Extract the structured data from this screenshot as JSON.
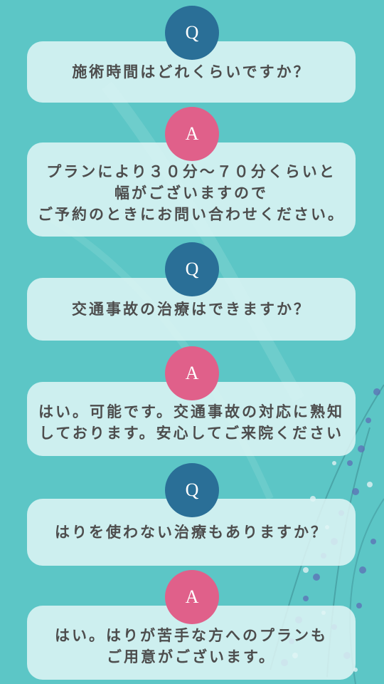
{
  "colors": {
    "background": "#5cc6c6",
    "q_badge": "#2a6f97",
    "a_badge": "#e0608a",
    "card": "#e0f6f6",
    "text": "#4d4d4d"
  },
  "faq": [
    {
      "q_badge": "Q",
      "question": [
        "施術時間はどれくらいですか？"
      ],
      "a_badge": "A",
      "answer": [
        "プランにより３０分〜７０分くらいと",
        "幅がございますので",
        "ご予約のときにお問い合わせください。"
      ]
    },
    {
      "q_badge": "Q",
      "question": [
        "交通事故の治療はできますか？"
      ],
      "a_badge": "A",
      "answer": [
        "はい。可能です。交通事故の対応に熟知",
        "しております。安心してご来院ください"
      ]
    },
    {
      "q_badge": "Q",
      "question": [
        "はりを使わない治療もありますか？"
      ],
      "a_badge": "A",
      "answer": [
        "はい。はりが苦手な方へのプランも",
        "ご用意がございます。"
      ]
    }
  ]
}
